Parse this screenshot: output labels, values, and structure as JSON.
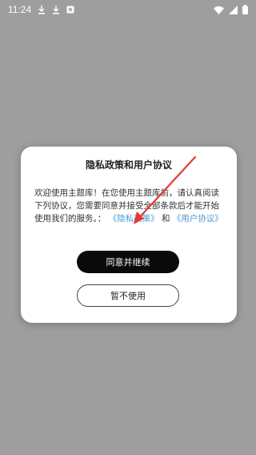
{
  "status_bar": {
    "time": "11:24",
    "left_icons": [
      "download-icon",
      "download-icon",
      "notification-app-icon"
    ],
    "right_icons": [
      "wifi-icon",
      "signal-icon",
      "battery-icon"
    ]
  },
  "dialog": {
    "title": "隐私政策和用户协议",
    "body_text": "欢迎使用主题库！在您使用主题库前，请认真阅读下列协议，您需要同意并接受全部条款后才能开始使用我们的服务。：",
    "privacy_link": "《隐私政策》",
    "and_text": "和",
    "user_agreement_link": "《用户协议》",
    "agree_button": "同意并继续",
    "decline_button": "暂不使用"
  },
  "colors": {
    "overlay": "#9e9e9e",
    "link": "#4f9ad6",
    "primary_button": "#0a0a0a",
    "arrow": "#e53935"
  }
}
